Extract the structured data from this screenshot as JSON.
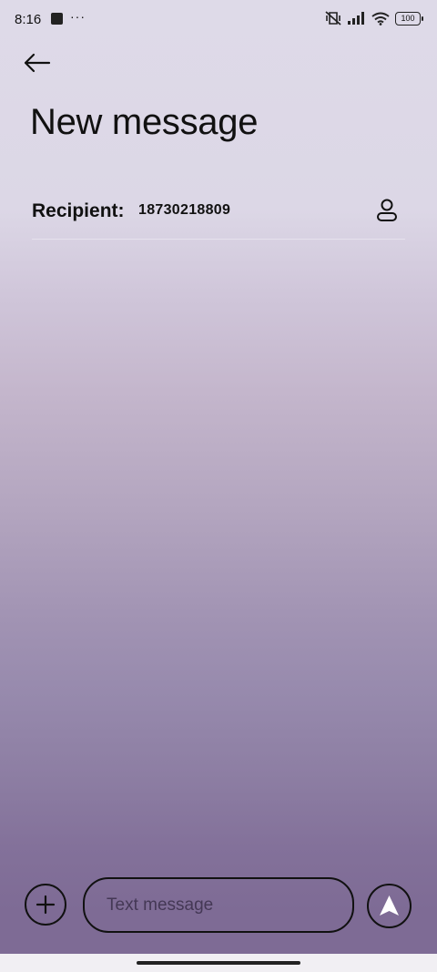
{
  "status_bar": {
    "time": "8:16",
    "dots": "···",
    "battery": "100",
    "icons": [
      "notification-square-icon",
      "vibrate-silent-icon",
      "signal-icon",
      "wifi-icon",
      "battery-icon"
    ]
  },
  "header": {
    "title": "New message",
    "back_icon": "back-arrow-icon"
  },
  "recipient": {
    "label": "Recipient:",
    "value": "18730218809",
    "contact_icon": "person-icon"
  },
  "composer": {
    "placeholder": "Text message",
    "attach_icon": "plus-icon",
    "send_icon": "send-icon"
  },
  "colors": {
    "text": "#111111",
    "background_top": "#dedae8",
    "background_bottom": "#7e6b95",
    "nav_bar": "#f1eff3"
  }
}
